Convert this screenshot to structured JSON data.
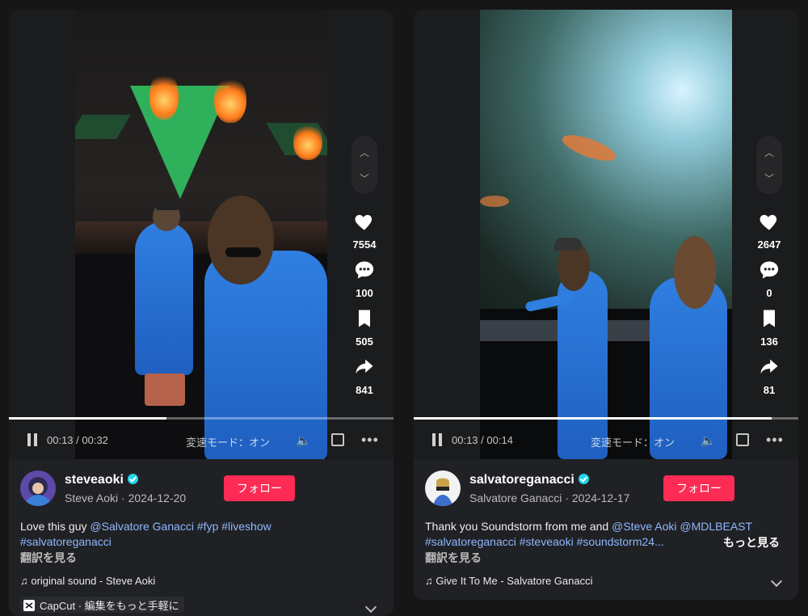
{
  "posts": [
    {
      "likes": "7554",
      "comments": "100",
      "saves": "505",
      "shares": "841",
      "time": "00:13 / 00:32",
      "progress_fraction": 0.41,
      "speed_label": "変速モード：オン",
      "username": "steveaoki",
      "display_name_date": "Steve Aoki · 2024-12-20",
      "follow_label": "フォロー",
      "caption_text": "Love this guy ",
      "caption_links": [
        "@Salvatore Ganacci",
        "#fyp",
        "#liveshow",
        "#salvatoreganacci"
      ],
      "translate_label": "翻訳を見る",
      "sound": "♫ original sound - Steve Aoki",
      "capcut_label": "CapCut · 編集をもっと手軽に"
    },
    {
      "likes": "2647",
      "comments": "0",
      "saves": "136",
      "shares": "81",
      "time": "00:13 / 00:14",
      "progress_fraction": 0.93,
      "speed_label": "変速モード：オン",
      "username": "salvatoreganacci",
      "display_name_date": "Salvatore Ganacci · 2024-12-17",
      "follow_label": "フォロー",
      "caption_text": "Thank you Soundstorm from me and ",
      "caption_links": [
        "@Steve Aoki",
        "@MDLBEAST",
        "#salvatoreganacci",
        "#steveaoki",
        "#soundstorm24..."
      ],
      "more_label": "もっと見る",
      "translate_label": "翻訳を見る",
      "sound": "♫ Give It To Me - Salvatore Ganacci"
    }
  ],
  "colors": {
    "follow": "#fe2c55",
    "link": "#8fb7ff",
    "verified": "#20d5ec"
  },
  "icons": [
    "heart-icon",
    "comment-icon",
    "bookmark-icon",
    "share-icon",
    "pause-icon",
    "volume-icon",
    "fullscreen-icon",
    "more-icon",
    "chevron-up-icon",
    "chevron-down-icon",
    "verified-icon",
    "music-note-icon",
    "capcut-icon"
  ]
}
